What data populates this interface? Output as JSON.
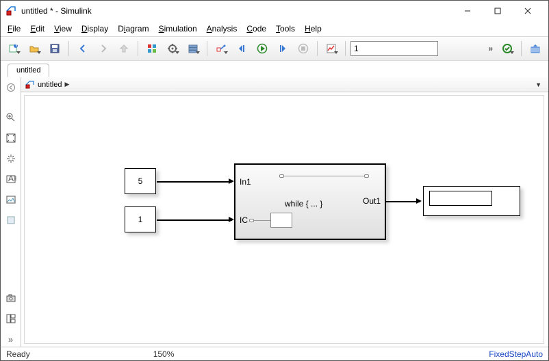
{
  "window": {
    "title": "untitled * - Simulink"
  },
  "menu": {
    "file": "File",
    "edit": "Edit",
    "view": "View",
    "display": "Display",
    "diagram": "Diagram",
    "simulation": "Simulation",
    "analysis": "Analysis",
    "code": "Code",
    "tools": "Tools",
    "help": "Help"
  },
  "toolbar": {
    "search_value": "1",
    "overflow": "»"
  },
  "tabs": {
    "tab1": "untitled"
  },
  "breadcrumb": {
    "root": "untitled",
    "chev": "▶",
    "drop": "▼"
  },
  "blocks": {
    "const1": "5",
    "const2": "1",
    "subsys": {
      "in1": "In1",
      "ic": "IC",
      "out1": "Out1",
      "caption": "while { ... }"
    }
  },
  "status": {
    "left": "Ready",
    "mid": "150%",
    "right": "FixedStepAuto"
  }
}
